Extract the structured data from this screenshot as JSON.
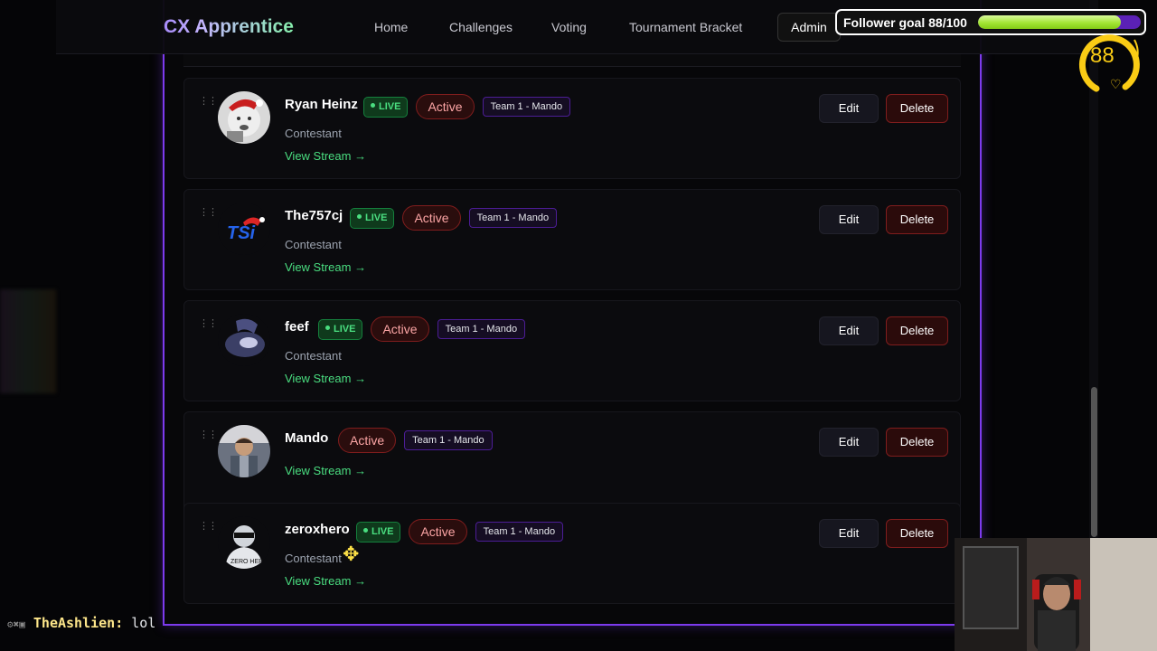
{
  "nav": {
    "logo": "CX Apprentice",
    "links": [
      "Home",
      "Challenges",
      "Voting",
      "Tournament Bracket"
    ],
    "admin": "Admin"
  },
  "overlay": {
    "follower_goal_label": "Follower goal 88/100",
    "follower_goal_progress": 0.88,
    "follower_count": "88"
  },
  "contestants": [
    {
      "name": "Ryan Heinz",
      "live": "LIVE",
      "status": "Active",
      "team": "Team 1 - Mando",
      "role": "Contestant",
      "stream": "View Stream →",
      "edit": "Edit",
      "delete": "Delete"
    },
    {
      "name": "The757cj",
      "live": "LIVE",
      "status": "Active",
      "team": "Team 1 - Mando",
      "role": "Contestant",
      "stream": "View Stream →",
      "edit": "Edit",
      "delete": "Delete"
    },
    {
      "name": "feef",
      "live": "LIVE",
      "status": "Active",
      "team": "Team 1 - Mando",
      "role": "Contestant",
      "stream": "View Stream →",
      "edit": "Edit",
      "delete": "Delete"
    },
    {
      "name": "Mando",
      "live": "",
      "status": "Active",
      "team": "Team 1 - Mando",
      "role": "",
      "stream": "View Stream →",
      "edit": "Edit",
      "delete": "Delete"
    },
    {
      "name": "zeroxhero",
      "live": "LIVE",
      "status": "Active",
      "team": "Team 1 - Mando",
      "role": "Contestant",
      "stream": "View Stream →",
      "edit": "Edit",
      "delete": "Delete"
    }
  ],
  "chat": {
    "user": "TheAshlien",
    "message": "lol"
  },
  "colors": {
    "accent": "#7c3aed",
    "live_green": "#4ade80",
    "goal_fill": "#a3e635",
    "delete_red": "#7f1d1d"
  }
}
